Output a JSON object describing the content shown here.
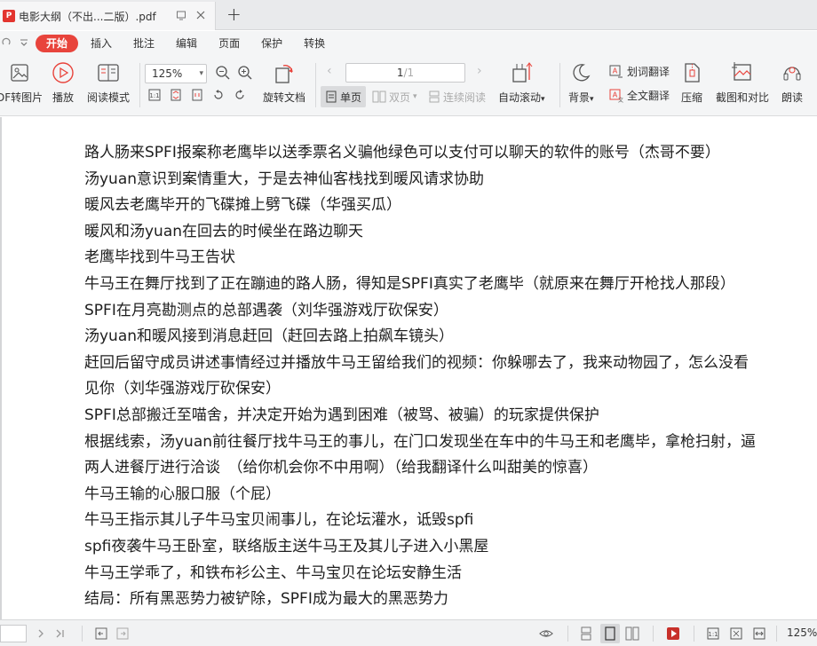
{
  "tab": {
    "badge": "P",
    "title": "电影大纲（不出...二版）.pdf",
    "new_tab": "+"
  },
  "menu": {
    "items": [
      "开始",
      "插入",
      "批注",
      "编辑",
      "页面",
      "保护",
      "转换"
    ],
    "active_index": 0
  },
  "toolbar": {
    "pdf_to_image": "DF转图片",
    "play": "播放",
    "reading_mode": "阅读模式",
    "zoom": "125%",
    "rotate": "旋转文档",
    "page_current": "1",
    "page_total": "/1",
    "single_page": "单页",
    "double_page": "双页",
    "continuous": "连续阅读",
    "auto_scroll": "自动滚动",
    "background": "背景",
    "word_translate": "划词翻译",
    "full_translate": "全文翻译",
    "compress": "压缩",
    "screenshot_compare": "截图和对比",
    "read_aloud": "朗读"
  },
  "document": {
    "lines": [
      "路人肠来SPFI报案称老鹰毕以送季票名义骗他绿色可以支付可以聊天的软件的账号（杰哥不要）",
      "汤yuan意识到案情重大，于是去神仙客栈找到暖风请求协助",
      "暖风去老鹰毕开的飞碟摊上劈飞碟（华强买瓜）",
      "暖风和汤yuan在回去的时候坐在路边聊天",
      "老鹰毕找到牛马王告状",
      "牛马王在舞厅找到了正在蹦迪的路人肠，得知是SPFI真实了老鹰毕（就原来在舞厅开枪找人那段）",
      "SPFI在月亮勘测点的总部遇袭（刘华强游戏厅砍保安）",
      "汤yuan和暖风接到消息赶回（赶回去路上拍飙车镜头）",
      "赶回后留守成员讲述事情经过并播放牛马王留给我们的视频：你躲哪去了，我来动物园了，怎么没看",
      "见你（刘华强游戏厅砍保安）",
      "SPFI总部搬迁至喵舍，并决定开始为遇到困难（被骂、被骗）的玩家提供保护",
      "根据线索，汤yuan前往餐厅找牛马王的事儿，在门口发现坐在车中的牛马王和老鹰毕，拿枪扫射，逼",
      "两人进餐厅进行洽谈　（给你机会你不中用啊）（给我翻译什么叫甜美的惊喜）",
      "牛马王输的心服口服（个屁）",
      "牛马王指示其儿子牛马宝贝闹事儿，在论坛灌水，诋毁spfi",
      "spfi夜袭牛马王卧室，联络版主送牛马王及其儿子进入小黑屋",
      "牛马王学乖了，和铁布衫公主、牛马宝贝在论坛安静生活",
      "结局：所有黑恶势力被铲除，SPFI成为最大的黑恶势力"
    ]
  },
  "statusbar": {
    "zoom": "125%"
  },
  "colors": {
    "accent": "#e8443c",
    "pdf_red": "#e3342f",
    "toolbar_bg": "#f4f5f6"
  }
}
